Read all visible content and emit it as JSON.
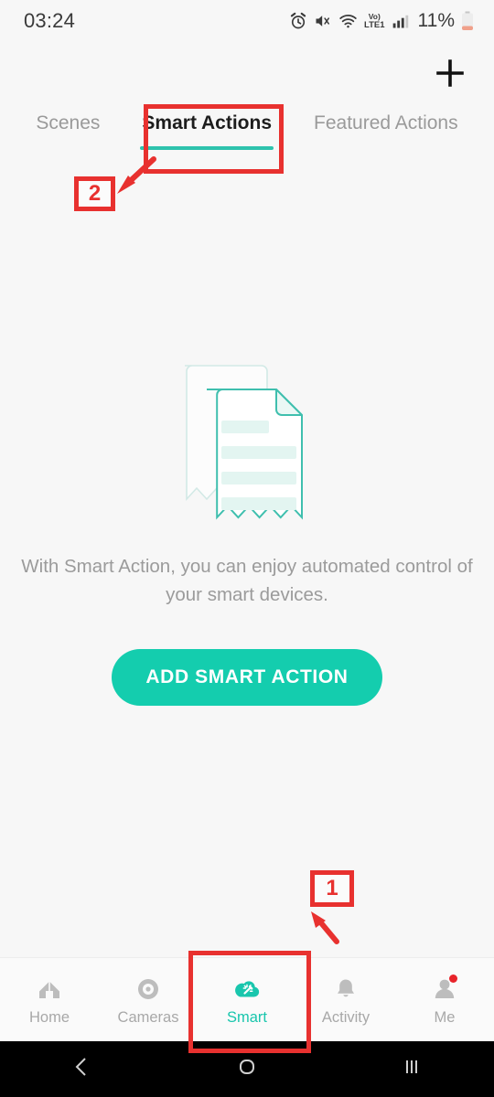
{
  "status_bar": {
    "time": "03:24",
    "battery_percent": "11%",
    "network_label": "LTE1",
    "volte_label": "Vo)",
    "icons": [
      "alarm-icon",
      "mute-icon",
      "wifi-icon",
      "volte-icon",
      "signal-icon",
      "battery-icon"
    ]
  },
  "header": {
    "add_icon": "plus-icon"
  },
  "tabs": [
    {
      "label": "Scenes",
      "active": false
    },
    {
      "label": "Smart Actions",
      "active": true
    },
    {
      "label": "Featured Actions",
      "active": false
    }
  ],
  "empty_state": {
    "illustration": "documents-icon",
    "description": "With Smart Action, you can enjoy automated control of your smart devices.",
    "cta_label": "ADD SMART ACTION"
  },
  "bottom_nav": [
    {
      "label": "Home",
      "icon": "house-icon",
      "active": false,
      "badge": false
    },
    {
      "label": "Cameras",
      "icon": "camera-lens-icon",
      "active": false,
      "badge": false
    },
    {
      "label": "Smart",
      "icon": "smart-cloud-wand-icon",
      "active": true,
      "badge": false
    },
    {
      "label": "Activity",
      "icon": "bell-icon",
      "active": false,
      "badge": false
    },
    {
      "label": "Me",
      "icon": "person-icon",
      "active": false,
      "badge": true
    }
  ],
  "system_nav": [
    {
      "icon": "back-icon"
    },
    {
      "icon": "home-icon"
    },
    {
      "icon": "recents-icon"
    }
  ],
  "annotations": [
    {
      "number": "1",
      "target": "bottom-nav-smart"
    },
    {
      "number": "2",
      "target": "tab-smart-actions"
    }
  ],
  "colors": {
    "accent_teal": "#14cdae",
    "tab_underline": "#2ec3ad",
    "annotation_red": "#e8312f",
    "background": "#f7f7f7",
    "badge_red": "#e8232a"
  }
}
